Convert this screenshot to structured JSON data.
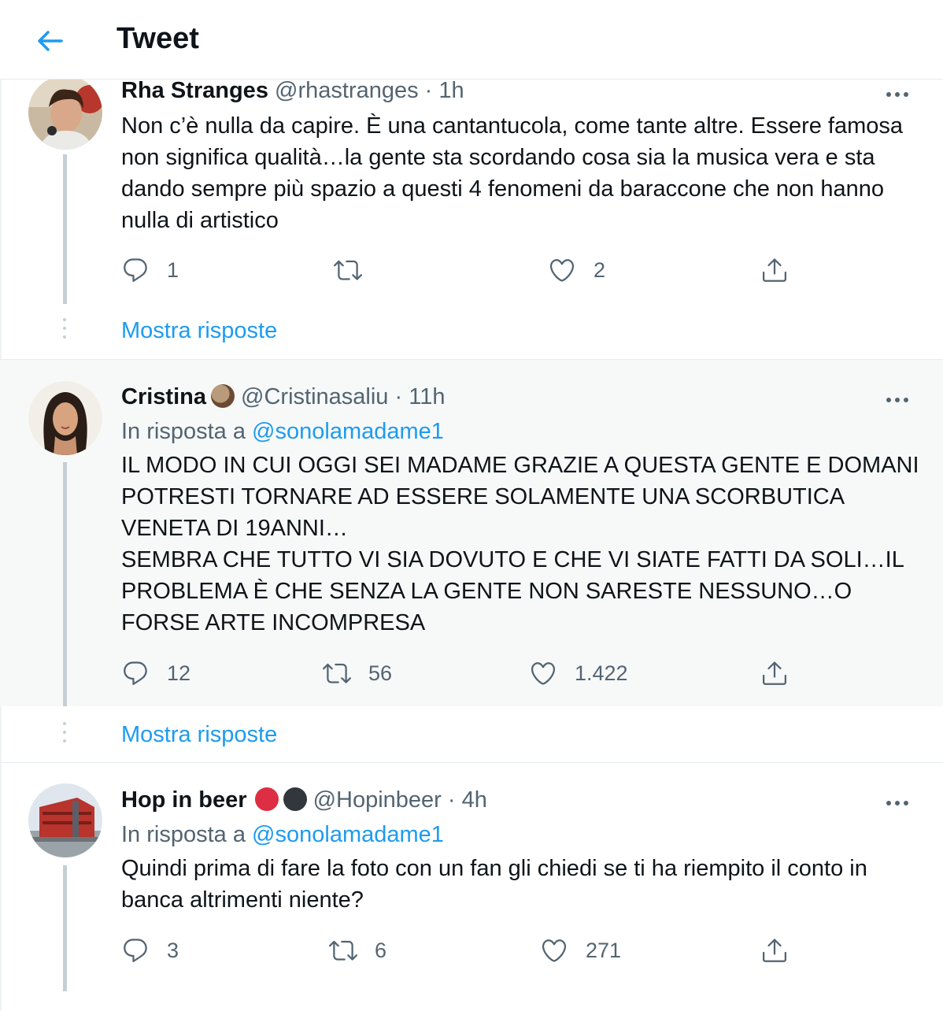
{
  "header": {
    "title": "Tweet"
  },
  "tweets": [
    {
      "name": "Rha Stranges",
      "handle": "@rhastranges",
      "sep": "·",
      "time": "1h",
      "text": "Non c’è nulla da capire. È una cantantucola, come tante altre. Essere famosa non significa qualità…la gente sta scordando cosa sia la musica vera e sta dando sempre più spazio a questi 4 fenomeni da baraccone che non hanno nulla di artistico",
      "replies": "1",
      "retweets": "",
      "likes": "2",
      "show_replies": "Mostra risposte"
    },
    {
      "name": "Cristina",
      "handle": "@Cristinasaliu",
      "sep": "·",
      "time": "11h",
      "reply_prefix": "In risposta a",
      "reply_to": "@sonolamadame1",
      "text": "IL MODO IN CUI OGGI SEI MADAME GRAZIE A QUESTA GENTE E DOMANI POTRESTI TORNARE AD ESSERE SOLAMENTE UNA SCORBUTICA VENETA DI 19ANNI…\nSEMBRA CHE TUTTO VI SIA DOVUTO E CHE VI SIATE FATTI DA SOLI…IL PROBLEMA È CHE SENZA LA GENTE NON SARESTE NESSUNO…O FORSE ARTE INCOMPRESA",
      "replies": "12",
      "retweets": "56",
      "likes": "1.422",
      "show_replies": "Mostra risposte"
    },
    {
      "name": "Hop in beer",
      "handle": "@Hopinbeer",
      "sep": "·",
      "time": "4h",
      "reply_prefix": "In risposta a",
      "reply_to": "@sonolamadame1",
      "text": "Quindi prima di fare la foto con un fan gli chiedi se ti ha riempito il conto in banca altrimenti niente?",
      "replies": "3",
      "retweets": "6",
      "likes": "271"
    }
  ],
  "icons": [
    "back-arrow-icon",
    "more-icon",
    "reply-icon",
    "retweet-icon",
    "like-icon",
    "share-icon",
    "coconut-emoji-icon",
    "red-circle-emoji-icon",
    "black-circle-emoji-icon"
  ],
  "colors": {
    "accent": "#1d9bf0",
    "secondary_text": "#536471",
    "shaded_bg": "#f7f9f9"
  }
}
